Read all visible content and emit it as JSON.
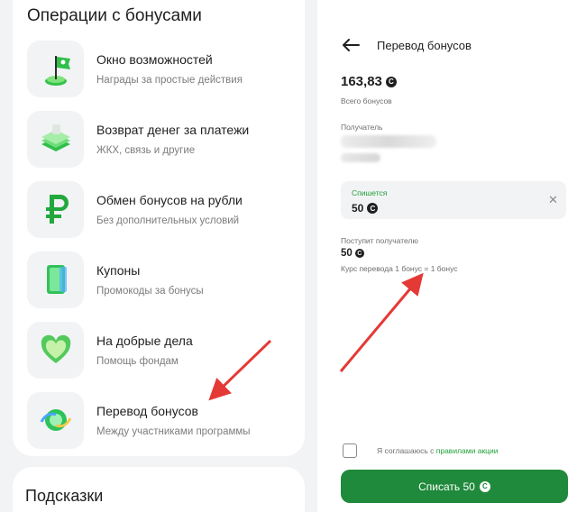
{
  "operations": {
    "title": "Операции с бонусами",
    "items": [
      {
        "title": "Окно возможностей",
        "subtitle": "Награды за простые действия",
        "icon": "flag-icon"
      },
      {
        "title": "Возврат денег за платежи",
        "subtitle": "ЖКХ, связь и другие",
        "icon": "money-stack-icon"
      },
      {
        "title": "Обмен бонусов на рубли",
        "subtitle": "Без дополнительных условий",
        "icon": "ruble-icon"
      },
      {
        "title": "Купоны",
        "subtitle": "Промокоды за бонусы",
        "icon": "coupon-icon"
      },
      {
        "title": "На добрые дела",
        "subtitle": "Помощь фондам",
        "icon": "heart-icon"
      },
      {
        "title": "Перевод бонусов",
        "subtitle": "Между участниками программы",
        "icon": "transfer-icon"
      }
    ]
  },
  "hints": {
    "title": "Подсказки"
  },
  "transfer": {
    "title": "Перевод бонусов",
    "balance": "163,83",
    "balance_label": "Всего бонусов",
    "recipient_label": "Получатель",
    "debit_label": "Спишется",
    "debit_value": "50",
    "receive_label": "Поступит получателю",
    "receive_value": "50",
    "rate_text": "Курс перевода 1 бонус = 1 бонус",
    "agree_prefix": "Я соглашаюсь с ",
    "agree_link": "правилами акции",
    "submit_label": "Списать 50"
  },
  "colors": {
    "brand_green": "#21a038",
    "button_green": "#1f8a3b",
    "annotation_red": "#e53935"
  }
}
